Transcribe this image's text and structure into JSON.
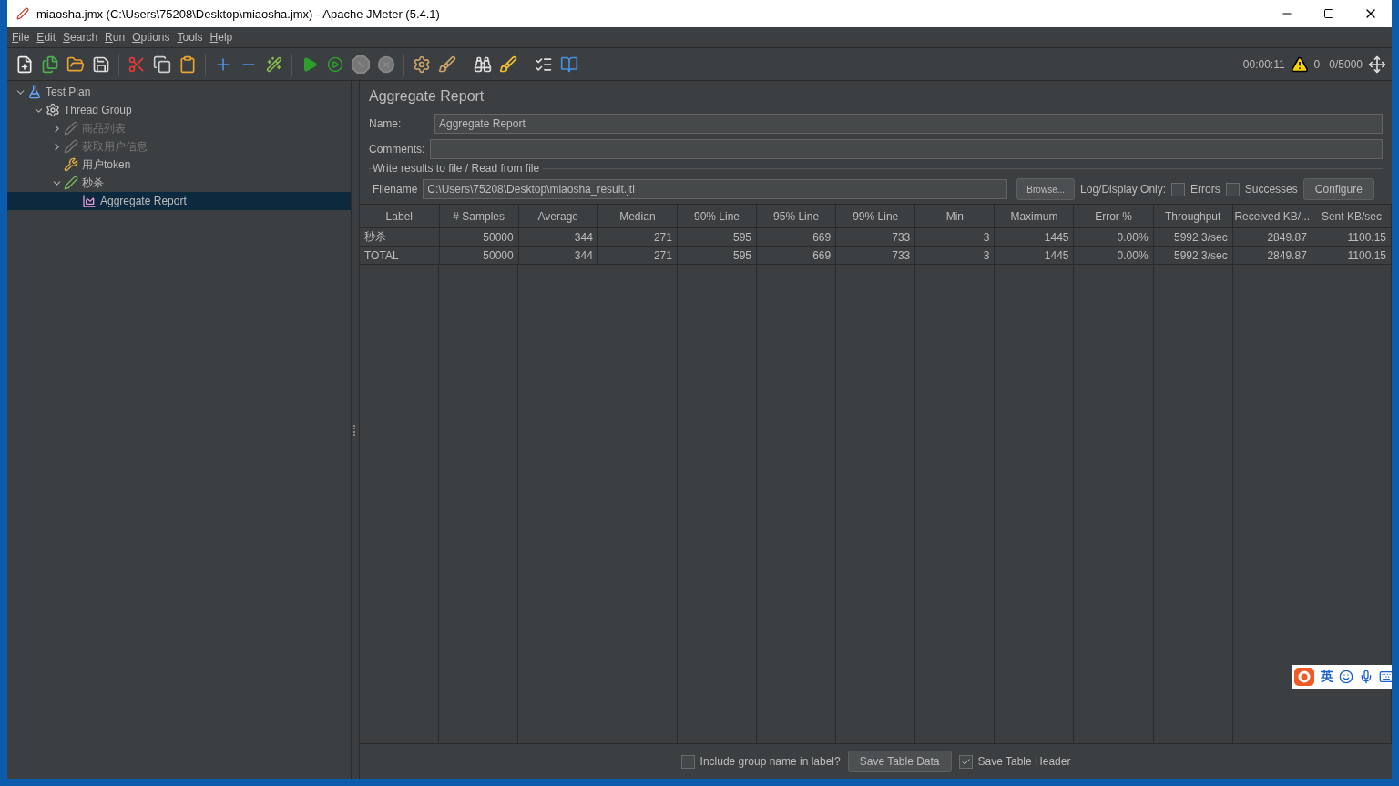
{
  "window": {
    "title": "miaosha.jmx (C:\\Users\\75208\\Desktop\\miaosha.jmx) - Apache JMeter (5.4.1)"
  },
  "menu": [
    {
      "label": "File"
    },
    {
      "label": "Edit"
    },
    {
      "label": "Search"
    },
    {
      "label": "Run"
    },
    {
      "label": "Options"
    },
    {
      "label": "Tools"
    },
    {
      "label": "Help"
    }
  ],
  "status": {
    "elapsed": "00:00:11",
    "warnings": "0",
    "threads": "0/5000"
  },
  "tree": [
    {
      "label": "Test Plan",
      "kind": "plan",
      "expanded": true,
      "disabled": false,
      "selected": false,
      "children": [
        {
          "label": "Thread Group",
          "kind": "threads",
          "expanded": true,
          "disabled": false,
          "selected": false,
          "children": [
            {
              "label": "商品列表",
              "kind": "sampler",
              "expanded": false,
              "disabled": true,
              "selected": false
            },
            {
              "label": "获取用户信息",
              "kind": "sampler",
              "expanded": false,
              "disabled": true,
              "selected": false
            },
            {
              "label": "用户token",
              "kind": "config",
              "disabled": false,
              "selected": false
            },
            {
              "label": "秒杀",
              "kind": "sampler",
              "expanded": true,
              "disabled": false,
              "selected": false,
              "children": [
                {
                  "label": "Aggregate Report",
                  "kind": "listener",
                  "disabled": false,
                  "selected": true
                }
              ]
            }
          ]
        }
      ]
    }
  ],
  "panel": {
    "title": "Aggregate Report",
    "name_label": "Name:",
    "name_value": "Aggregate Report",
    "comments_label": "Comments:",
    "file_section": "Write results to file / Read from file",
    "filename_label": "Filename",
    "filename_value": "C:\\Users\\75208\\Desktop\\miaosha_result.jtl",
    "browse_button": "Browse...",
    "log_label": "Log/Display Only:",
    "errors": {
      "label": "Errors",
      "checked": false
    },
    "successes": {
      "label": "Successes",
      "checked": false
    },
    "configure_button": "Configure"
  },
  "table": {
    "columns": [
      "Label",
      "# Samples",
      "Average",
      "Median",
      "90% Line",
      "95% Line",
      "99% Line",
      "Min",
      "Maximum",
      "Error %",
      "Throughput",
      "Received KB/...",
      "Sent KB/sec"
    ],
    "rows": [
      [
        "秒杀",
        "50000",
        "344",
        "271",
        "595",
        "669",
        "733",
        "3",
        "1445",
        "0.00%",
        "5992.3/sec",
        "2849.87",
        "1100.15"
      ],
      [
        "TOTAL",
        "50000",
        "344",
        "271",
        "595",
        "669",
        "733",
        "3",
        "1445",
        "0.00%",
        "5992.3/sec",
        "2849.87",
        "1100.15"
      ]
    ]
  },
  "footer": {
    "include_group": {
      "label": "Include group name in label?",
      "checked": false
    },
    "save_data_button": "Save Table Data",
    "save_header": {
      "label": "Save Table Header",
      "checked": true
    }
  },
  "ime": {
    "label": "英"
  }
}
